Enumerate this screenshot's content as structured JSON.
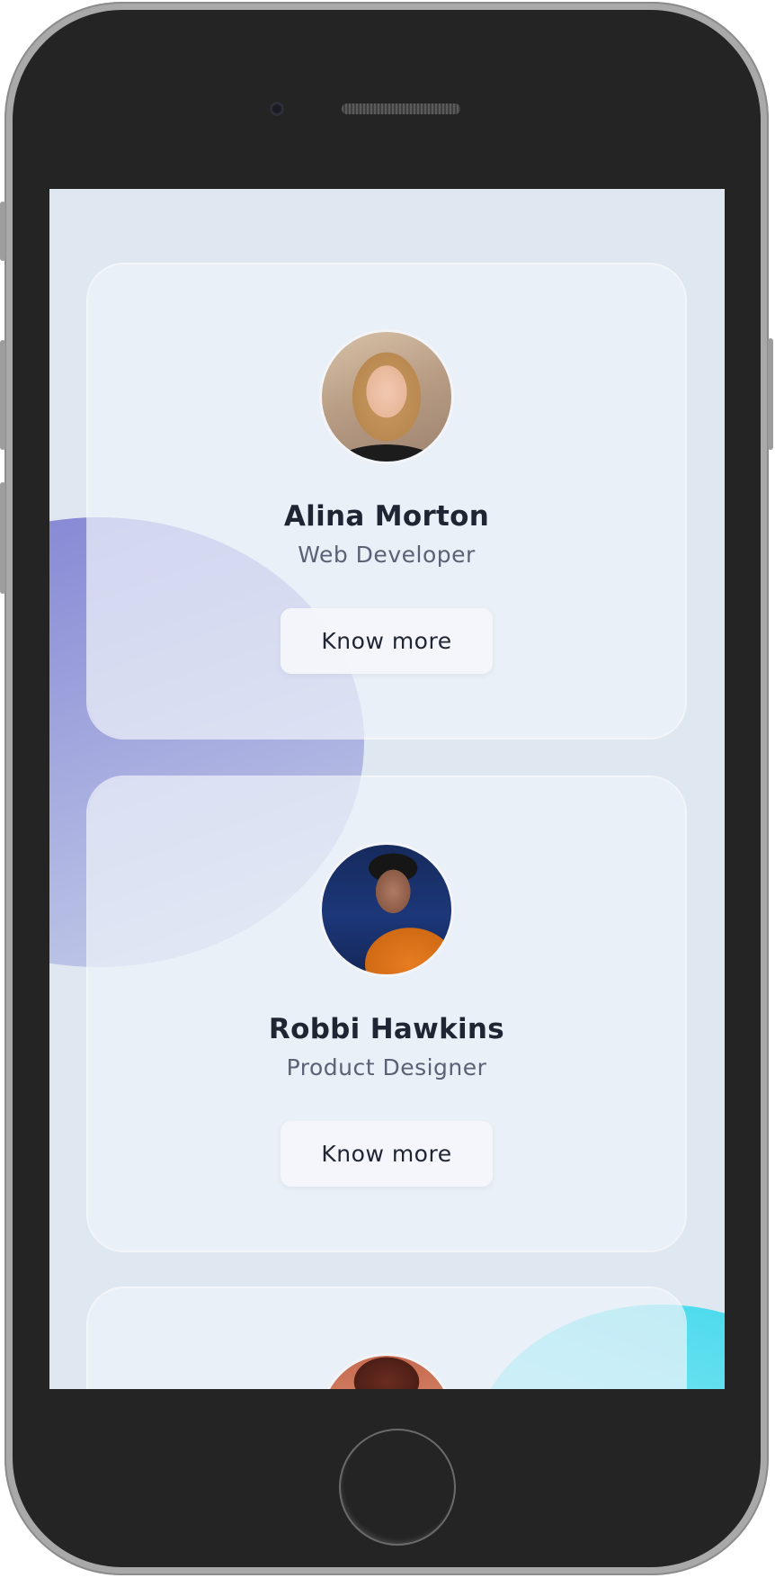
{
  "screen": {
    "background": "#dfe8f1",
    "accent_purple": "#7f80d2",
    "accent_cyan": "#3fd8ec"
  },
  "cards": [
    {
      "name": "Alina Morton",
      "role": "Web Developer",
      "button_label": "Know more",
      "avatar": "portrait-woman"
    },
    {
      "name": "Robbi Hawkins",
      "role": "Product Designer",
      "button_label": "Know more",
      "avatar": "portrait-man"
    },
    {
      "name": "",
      "role": "",
      "button_label": "",
      "avatar": "portrait-partial"
    }
  ]
}
